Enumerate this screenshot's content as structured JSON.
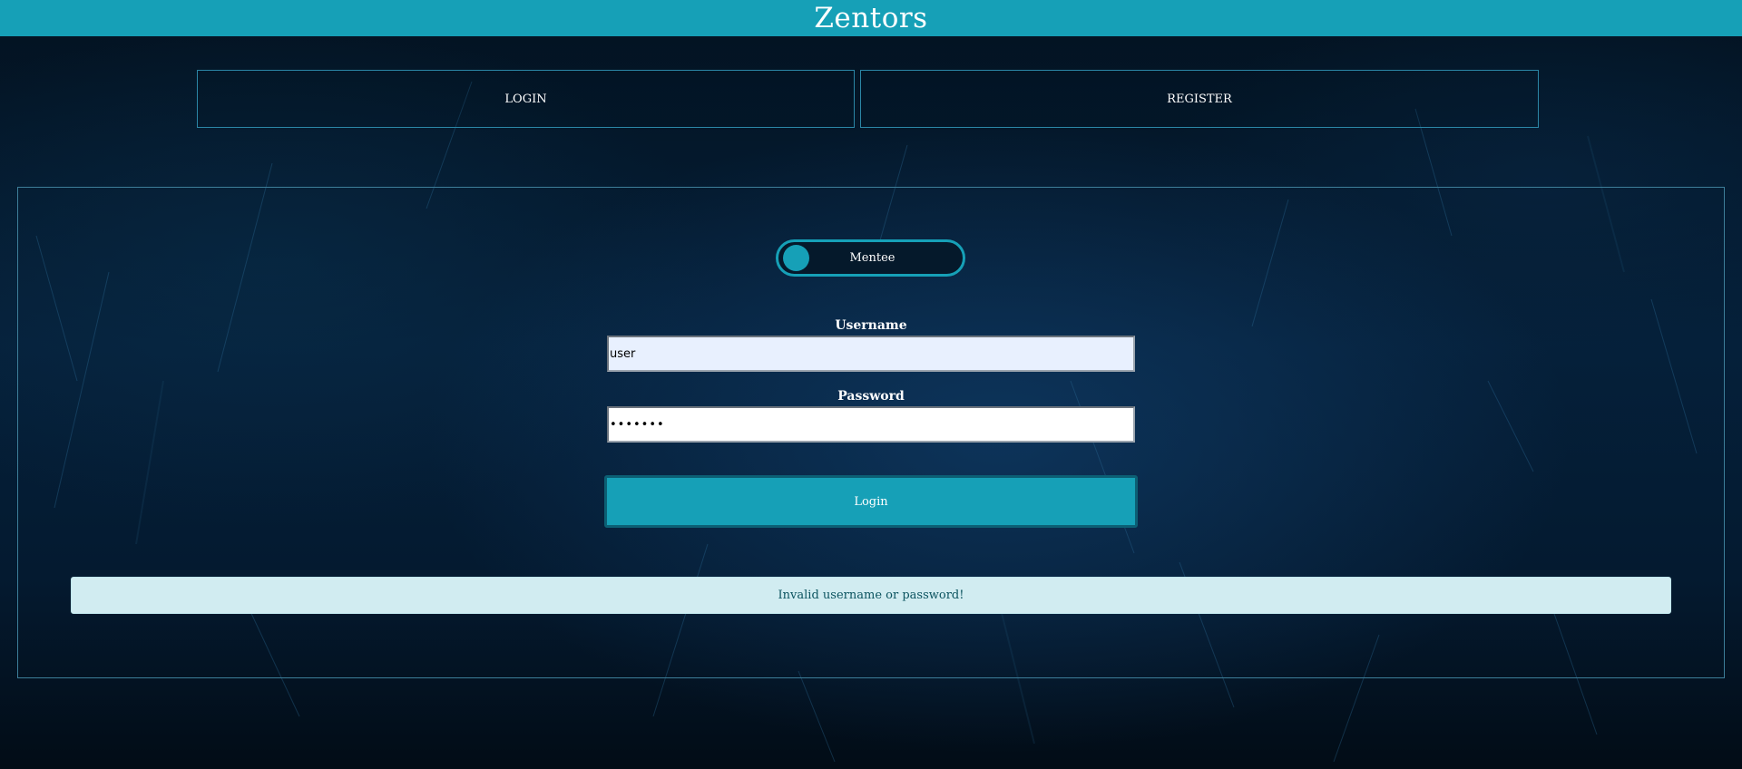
{
  "header": {
    "brand": "Zentors"
  },
  "nav": {
    "login_label": "LOGIN",
    "register_label": "REGISTER"
  },
  "form": {
    "role_toggle": {
      "label": "Mentee",
      "state": "off"
    },
    "username": {
      "label": "Username",
      "value": "user"
    },
    "password": {
      "label": "Password",
      "value": "•••••••"
    },
    "submit_label": "Login"
  },
  "alert": {
    "message": "Invalid username or password!"
  },
  "colors": {
    "accent": "#16a0b7",
    "alert_bg": "#d1ecf1",
    "alert_text": "#0c5460",
    "background": "#05203a"
  }
}
